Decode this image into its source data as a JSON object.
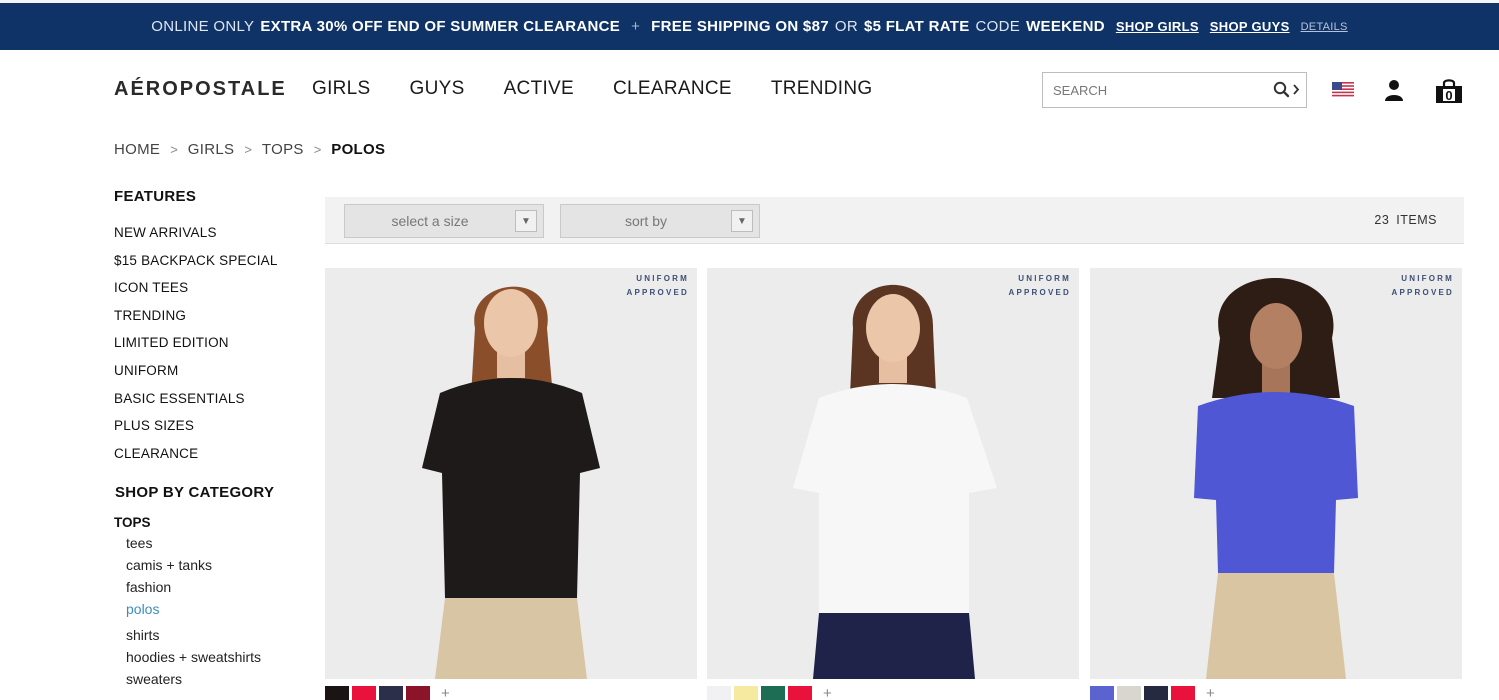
{
  "promo": {
    "online_only": "ONLINE ONLY",
    "offer1": "EXTRA 30% OFF END OF SUMMER CLEARANCE",
    "plus": "+",
    "shipping_a": "FREE SHIPPING ON $87",
    "or": "OR",
    "shipping_b": "$5 FLAT RATE",
    "code_label": "CODE",
    "code": "WEEKEND",
    "shop_girls": "SHOP GIRLS",
    "shop_guys": "SHOP GUYS",
    "details": "DETAILS"
  },
  "header": {
    "logo": "AÉROPOSTALE",
    "nav": [
      "GIRLS",
      "GUYS",
      "ACTIVE",
      "CLEARANCE",
      "TRENDING"
    ],
    "search_placeholder": "SEARCH",
    "bag_count": "0"
  },
  "breadcrumb": {
    "items": [
      "HOME",
      "GIRLS",
      "TOPS"
    ],
    "current": "POLOS",
    "separator": ">"
  },
  "sidebar": {
    "features_heading": "FEATURES",
    "features": [
      "NEW ARRIVALS",
      "$15 BACKPACK SPECIAL",
      "ICON TEES",
      "TRENDING",
      "LIMITED EDITION",
      "UNIFORM",
      "BASIC ESSENTIALS",
      "PLUS SIZES",
      "CLEARANCE"
    ],
    "category_heading": "SHOP BY CATEGORY",
    "tops_label": "TOPS",
    "tops_items": [
      "tees",
      "camis + tanks",
      "fashion",
      "polos",
      "shirts",
      "hoodies + sweatshirts",
      "sweaters"
    ],
    "active_item": "polos"
  },
  "toolbar": {
    "size_placeholder": "select a size",
    "sort_placeholder": "sort by",
    "dropdown_arrow": "▼",
    "items_count": "23",
    "items_label": "ITEMS"
  },
  "products": [
    {
      "badge_line1": "UNIFORM",
      "badge_line2": "APPROVED",
      "shirt_color": "#1d1a19",
      "hair_color": "#8a4f2a",
      "bottom_color": "#d8c5a3",
      "swatches": [
        "#1a1414",
        "#e8123c",
        "#2b2f4a",
        "#8c1428"
      ],
      "more": "+"
    },
    {
      "badge_line1": "UNIFORM",
      "badge_line2": "APPROVED",
      "shirt_color": "#f7f7f7",
      "hair_color": "#5b3522",
      "bottom_color": "#1f2249",
      "swatches": [
        "#f1f1f4",
        "#f6eaa0",
        "#1d6d55",
        "#e8123c"
      ],
      "more": "+"
    },
    {
      "badge_line1": "UNIFORM",
      "badge_line2": "APPROVED",
      "shirt_color": "#4f57d4",
      "hair_color": "#2e1d14",
      "bottom_color": "#d9c5a2",
      "swatches": [
        "#5a63cf",
        "#d9d6d0",
        "#252a40",
        "#e8123c"
      ],
      "more": "+"
    }
  ]
}
